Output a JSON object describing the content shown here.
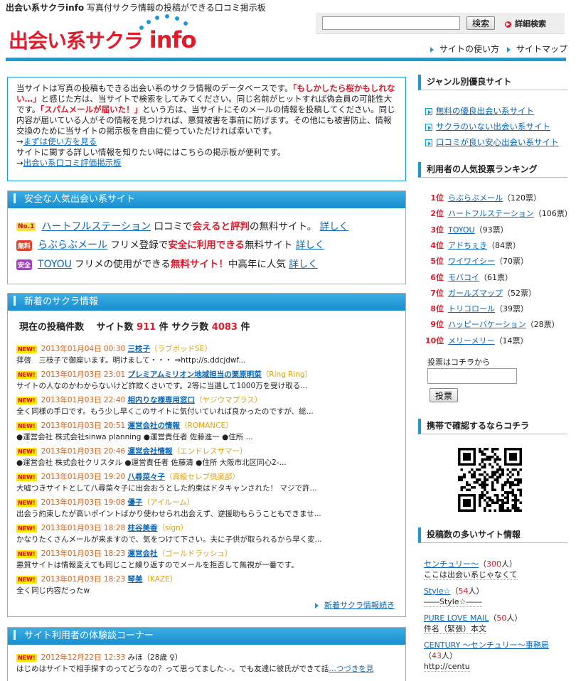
{
  "header": {
    "site_name": "出会い系サクラinfo",
    "tagline": "写真付サクラ情報の投稿ができる口コミ掲示板",
    "logo_text": "出会い系サクラ",
    "logo_suffix": "info",
    "search_placeholder": "",
    "search_button": "検索",
    "advanced_search": "詳細検索",
    "nav": [
      "サイトの使い方",
      "サイトマップ"
    ]
  },
  "intro": {
    "p1": "当サイトは写真の投稿もできる出会い系のサクラ情報のデータベースです。",
    "em1": "「もしかしたら桜かもしれない…」",
    "p2": "と感じた方は、当サイトで検索をしてみてください。同じ名前がヒットすれば偽会員の可能性大です。",
    "em2": "「スパムメールが届いた！」",
    "p3": "という方は、当サイトにそのメールの情報を投稿してください。同じ内容が届いている人がその情報を見つければ、悪質被害を事前に防げます。その他にも被害防止、情報交換のために当サイトの掲示板を自由に使っていただければ幸いです。",
    "link1": "まずは使い方を見る",
    "p4": "サイトに関する詳しい情報を知りたい時にはこちらの掲示板が便利です。",
    "link2": "出会い系口コミ評価掲示板",
    "arrow": "→"
  },
  "safe": {
    "title": "安全な人気出会い系サイト",
    "items": [
      {
        "badge": "No.1",
        "name": "ハートフルステーション",
        "pre": "口コミで",
        "hl": "会えると評判",
        "post": "の無料サイト。",
        "more": "詳しく"
      },
      {
        "badge": "無料",
        "name": "らぶらぶメール",
        "pre": "フリメ登録で",
        "hl": "安全に利用できる",
        "post": "無料サイト",
        "more": "詳しく"
      },
      {
        "badge": "安全",
        "name": "TOYOU",
        "pre": "フリメの使用ができる",
        "hl": "無料サイト！",
        "post": "中高年に人気",
        "more": "詳しく"
      }
    ]
  },
  "news": {
    "title": "新着のサクラ情報",
    "count_label": "現在の投稿件数　 サイト数",
    "site_count": "911",
    "count_mid": "件 サクラ数",
    "sakura_count": "4083",
    "count_end": "件",
    "new_badge": "NEW!",
    "items": [
      {
        "date": "2013年01月04日 00:30",
        "subject": "三枝子",
        "source": "（ラブポッドSE）",
        "body": "拝啓　三枝子で御座います。明けまして・・・ ⇒http://s.ddcjdwf..."
      },
      {
        "date": "2013年01月03日 23:01",
        "subject": "プレミアムミリオン地域担当の栗原明菜",
        "source": "（Ring Ring）",
        "body": "サイトの人なのかわからないけど詐欺くさいです。2等に当選して1000万を受け取る..."
      },
      {
        "date": "2013年01月03日 22:40",
        "subject": "相内りな様専用窓口",
        "source": "（ヤジウマプラス）",
        "body": "全く同様の手口です。もう少し早くこのサイトに気付いていれば良かったのですが、総..."
      },
      {
        "date": "2013年01月03日 20:51",
        "subject": "運営会社の情報",
        "source": "（ROMANCE）",
        "body": "●運営会社 株式会社sinwa planning ●運営責任者 佐藤進一 ●住所 ..."
      },
      {
        "date": "2013年01月03日 20:46",
        "subject": "運営会社情報",
        "source": "（エンドレスサマー）",
        "body": "●運営会社 株式会社クリスタル ●運営責任者 佐藤清 ●住所 大阪市北区同心2-..."
      },
      {
        "date": "2013年01月03日 19:20",
        "subject": "八尋菜々子",
        "source": "（高級セレブ倶楽部）",
        "body": "大嘘つきサイトとして八尋菜々子に出会おうとした約束はドタキャンされた！ マジで許..."
      },
      {
        "date": "2013年01月03日 19:08",
        "subject": "優子",
        "source": "（アイルーム）",
        "body": "出会う約束したが高いポイントばかり使わせられ出会えず、逆援助もらうこともできませ..."
      },
      {
        "date": "2013年01月03日 18:28",
        "subject": "柱谷美香",
        "source": "（sign）",
        "body": "かなりたくさんメールが来ますので、気をつけて下さい。夫に子供が取られるから早く変..."
      },
      {
        "date": "2013年01月03日 18:23",
        "subject": "運営会社",
        "source": "（ゴールドラッシュ）",
        "body": "悪質サイトは情報変えても同じこと繰り返すのでメールを拒否して無視が一番です。"
      },
      {
        "date": "2013年01月03日 18:23",
        "subject": "琴美",
        "source": "（KAZE）",
        "body": "全く同じ内容だったw"
      }
    ],
    "more": "新着サクラ情報続き"
  },
  "experience": {
    "title": "サイト利用者の体験談コーナー",
    "badge": "NEW!",
    "date": "2012年12月22日 12:33",
    "user": "みほ",
    "meta": "（28歳 ♀）",
    "body": "はじめはサイトで相手探すのってどうなの？って思ってました-.-。でも友達に彼氏ができて話",
    "more": "…つづきを見"
  },
  "sidebar": {
    "genre_title": "ジャンル別優良サイト",
    "genre_links": [
      "無料の優良出会い系サイト",
      "サクラのいない出会い系サイト",
      "口コミが良い安心出会い系サイト"
    ],
    "ranking_title": "利用者の人気投票ランキング",
    "ranking": [
      {
        "pos": "1位",
        "name": "らぶらぶメール",
        "votes": "（120票）"
      },
      {
        "pos": "2位",
        "name": "ハートフルステーション",
        "votes": "（106票）"
      },
      {
        "pos": "3位",
        "name": "TOYOU",
        "votes": "（93票）"
      },
      {
        "pos": "4位",
        "name": "アドちぇき",
        "votes": "（84票）"
      },
      {
        "pos": "5位",
        "name": "ワイワイシー",
        "votes": "（70票）"
      },
      {
        "pos": "6位",
        "name": "モバコイ",
        "votes": "（61票）"
      },
      {
        "pos": "7位",
        "name": "ガールズマップ",
        "votes": "（52票）"
      },
      {
        "pos": "8位",
        "name": "トリコロール",
        "votes": "（39票）"
      },
      {
        "pos": "9位",
        "name": "ハッピーバケーション",
        "votes": "（28票）"
      },
      {
        "pos": "10位",
        "name": "メリーメリー",
        "votes": "（14票）"
      }
    ],
    "vote_label": "投票はコチラから",
    "vote_button": "投票",
    "mobile_title": "携帯で確認するならコチラ",
    "posts_title": "投稿数の多いサイト情報",
    "posts": [
      {
        "name": "センチュリー～",
        "count": "300",
        "unit": "人",
        "desc": "ここは出会い系じゃなくて"
      },
      {
        "name": "Style☆",
        "count": "54",
        "unit": "人",
        "desc": "――Style☆――"
      },
      {
        "name": "PURE LOVE MAIL",
        "count": "50",
        "unit": "人",
        "desc": "件名（緊張）本文"
      },
      {
        "name": "CENTURY ～センチュリー～事務局",
        "count": "43",
        "unit": "人",
        "desc": "http://centu"
      }
    ]
  },
  "colors": {
    "accent": "#1c9ad6",
    "red": "#e01b2b",
    "link": "#0b67b5"
  }
}
